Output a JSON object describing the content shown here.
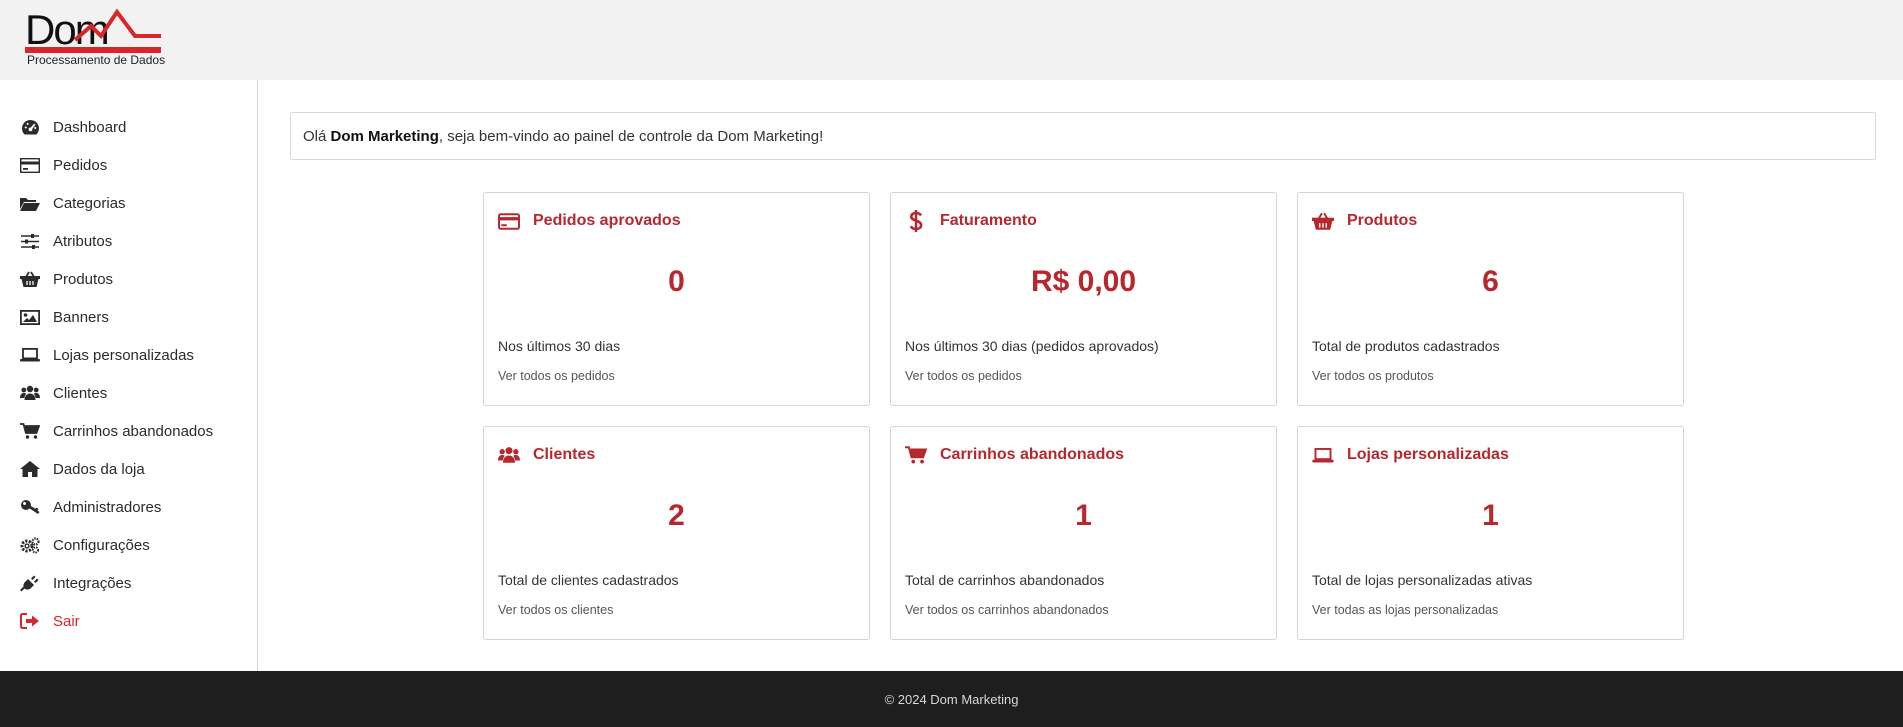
{
  "brand": {
    "logo_text": "Dom",
    "logo_subtitle": "Processamento de Dados"
  },
  "sidebar": {
    "items": [
      {
        "label": "Dashboard",
        "icon": "dashboard-icon"
      },
      {
        "label": "Pedidos",
        "icon": "credit-card-icon"
      },
      {
        "label": "Categorias",
        "icon": "folder-open-icon"
      },
      {
        "label": "Atributos",
        "icon": "sliders-icon"
      },
      {
        "label": "Produtos",
        "icon": "basket-icon"
      },
      {
        "label": "Banners",
        "icon": "image-icon"
      },
      {
        "label": "Lojas personalizadas",
        "icon": "laptop-icon"
      },
      {
        "label": "Clientes",
        "icon": "users-icon"
      },
      {
        "label": "Carrinhos abandonados",
        "icon": "cart-icon"
      },
      {
        "label": "Dados da loja",
        "icon": "home-icon"
      },
      {
        "label": "Administradores",
        "icon": "key-icon"
      },
      {
        "label": "Configurações",
        "icon": "gears-icon"
      },
      {
        "label": "Integrações",
        "icon": "plug-icon"
      },
      {
        "label": "Sair",
        "icon": "sign-out-icon"
      }
    ]
  },
  "welcome": {
    "prefix": "Olá ",
    "name": "Dom Marketing",
    "suffix": ", seja bem-vindo ao painel de controle da Dom Marketing!"
  },
  "cards": [
    {
      "title": "Pedidos aprovados",
      "icon": "credit-card-icon",
      "value": "0",
      "description": "Nos últimos 30 dias",
      "link": "Ver todos os pedidos"
    },
    {
      "title": "Faturamento",
      "icon": "dollar-icon",
      "value": "R$ 0,00",
      "description": "Nos últimos 30 dias (pedidos aprovados)",
      "link": "Ver todos os pedidos"
    },
    {
      "title": "Produtos",
      "icon": "basket-icon",
      "value": "6",
      "description": "Total de produtos cadastrados",
      "link": "Ver todos os produtos"
    },
    {
      "title": "Clientes",
      "icon": "users-icon",
      "value": "2",
      "description": "Total de clientes cadastrados",
      "link": "Ver todos os clientes"
    },
    {
      "title": "Carrinhos abandonados",
      "icon": "cart-icon",
      "value": "1",
      "description": "Total de carrinhos abandonados",
      "link": "Ver todos os carrinhos abandonados"
    },
    {
      "title": "Lojas personalizadas",
      "icon": "laptop-icon",
      "value": "1",
      "description": "Total de lojas personalizadas ativas",
      "link": "Ver todas as lojas personalizadas"
    }
  ],
  "footer": {
    "text": "© 2024 Dom Marketing"
  },
  "colors": {
    "accent": "#b7282e",
    "logout": "#d9262c",
    "topbar": "#f2f2f2",
    "footer": "#1e1e1e"
  }
}
